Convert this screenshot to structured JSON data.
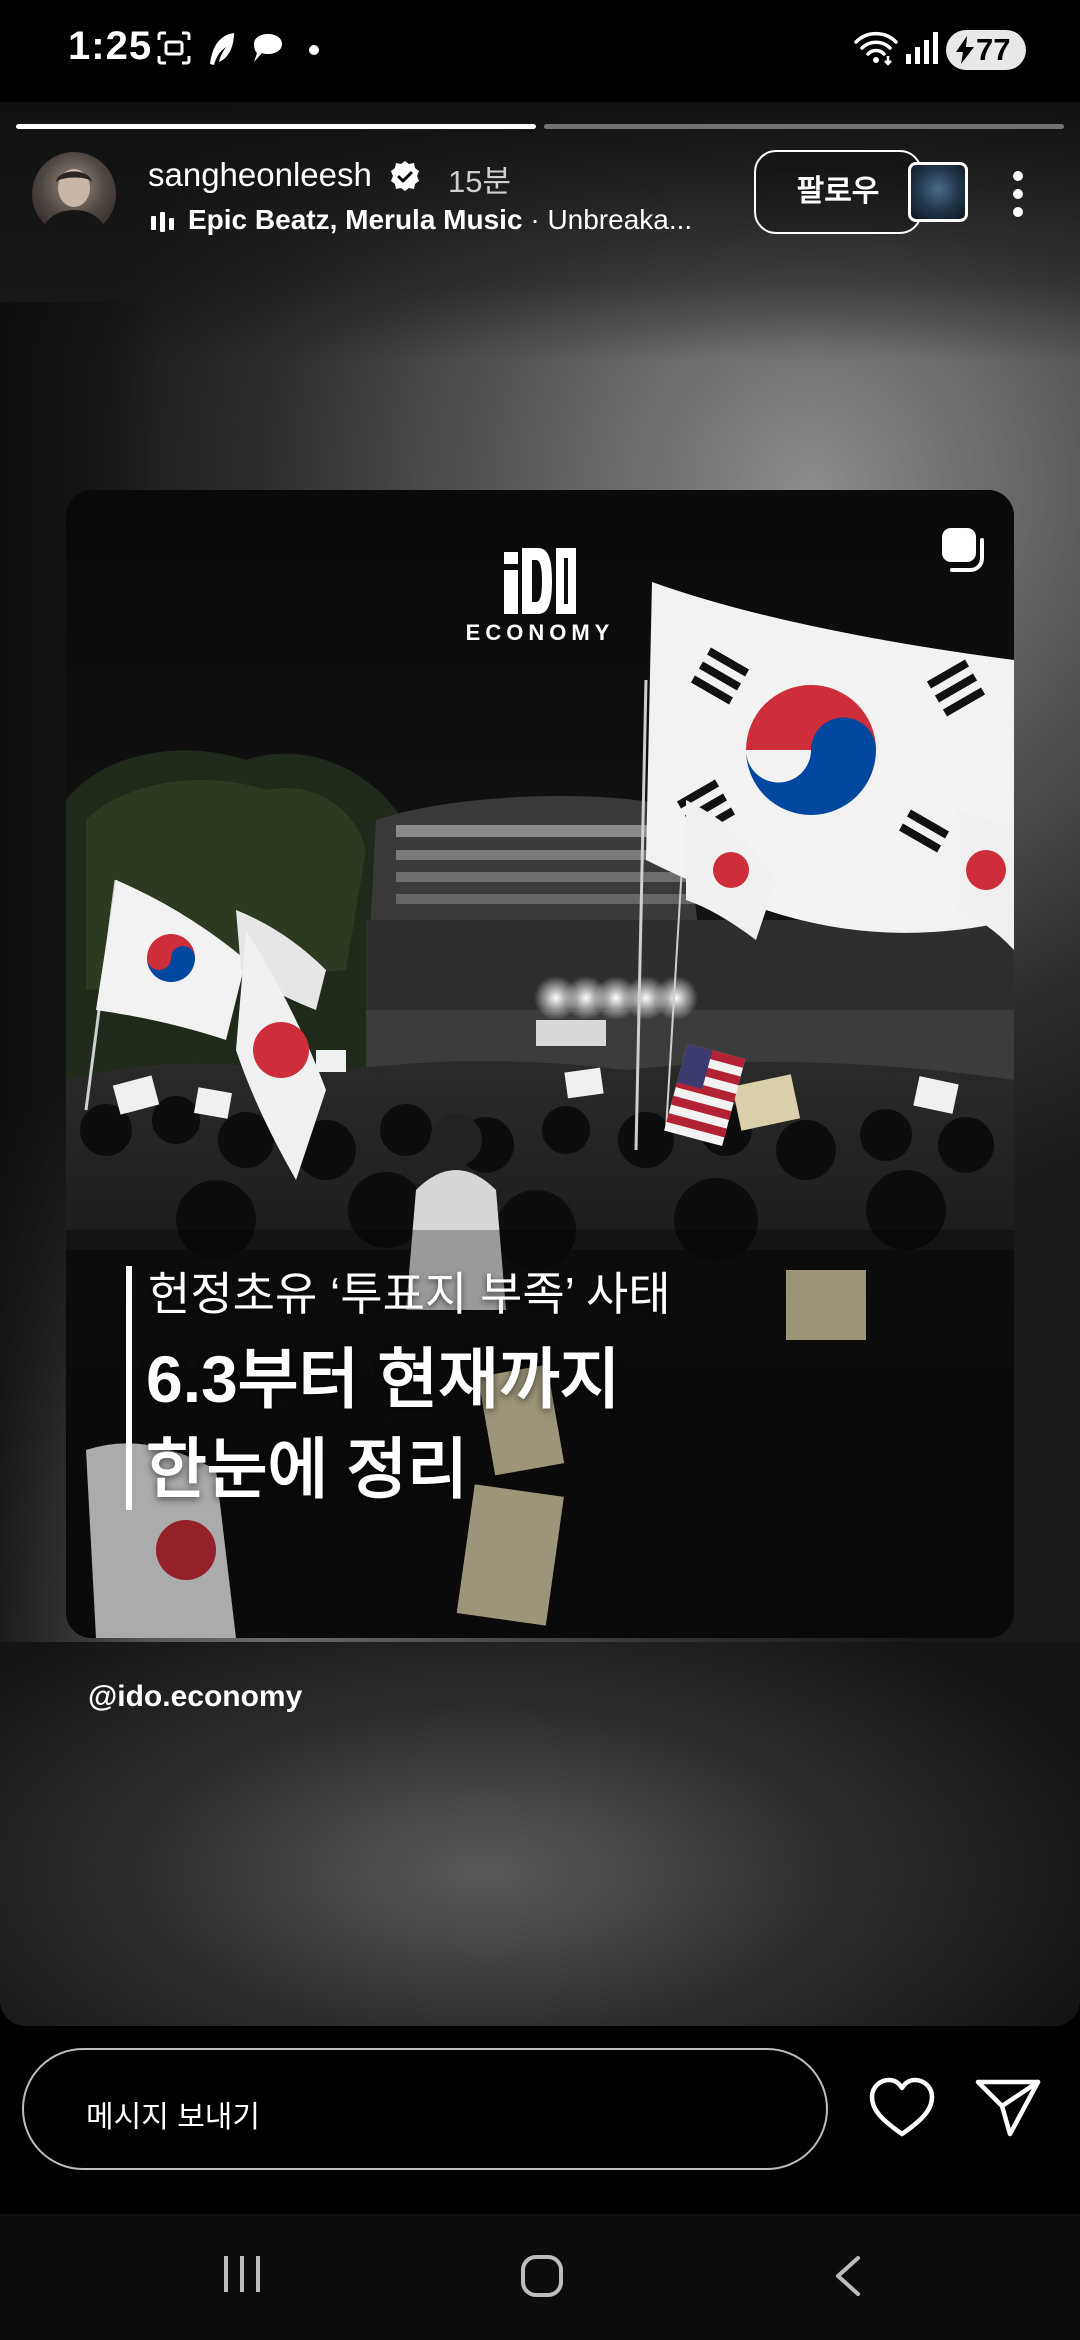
{
  "status_bar": {
    "time": "1:25",
    "battery": "77",
    "icons": [
      "screenshot-icon",
      "feather-app-icon",
      "threads-icon",
      "dot-icon",
      "wifi-icon",
      "signal-icon",
      "battery-icon"
    ]
  },
  "story": {
    "progress": [
      {
        "segment": 1,
        "fill": 1.0
      },
      {
        "segment": 2,
        "fill": 0.0
      }
    ],
    "header": {
      "username": "sangheonleesh",
      "time_ago": "15분",
      "music_artists": "Epic Beatz, Merula Music",
      "music_separator": " · ",
      "music_track": "Unbreaka...",
      "follow_label": "팔로우"
    },
    "card": {
      "logo_text": "ECONOMY",
      "headline_line1": "헌정초유 ‘투표지 부족’ 사태",
      "headline_line2": "6.3부터 현재까지",
      "headline_line3": "한눈에 정리"
    },
    "mention": "@ido.economy"
  },
  "reply_bar": {
    "placeholder": "메시지 보내기"
  },
  "nav_bar": {
    "buttons": [
      "recent-apps-icon",
      "home-icon",
      "back-icon"
    ]
  },
  "colors": {
    "background": "#000000",
    "flag_red": "#cd2e3a",
    "flag_blue": "#0047a0",
    "text": "#ffffff"
  }
}
